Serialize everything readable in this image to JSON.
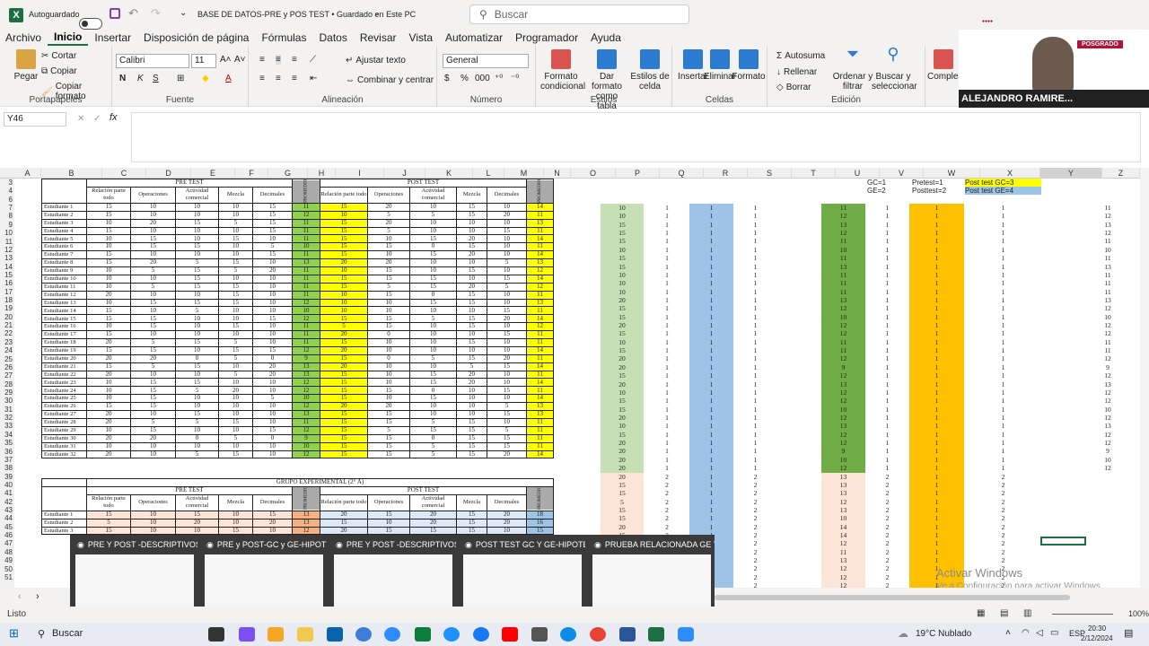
{
  "titlebar": {
    "autosave": "Autoguardado",
    "doc_title": "BASE DE DATOS-PRE y POS TEST • Guardado en Este PC"
  },
  "search": {
    "placeholder": "Buscar"
  },
  "menu": [
    "Archivo",
    "Inicio",
    "Insertar",
    "Disposición de página",
    "Fórmulas",
    "Datos",
    "Revisar",
    "Vista",
    "Automatizar",
    "Programador",
    "Ayuda"
  ],
  "ribbon": {
    "paste": "Pegar",
    "cut": "Cortar",
    "copy": "Copiar",
    "copy_format": "Copiar formato",
    "clipboard": "Portapapeles",
    "font_name": "Calibri",
    "font_size": "11",
    "font": "Fuente",
    "wrap": "Ajustar texto",
    "merge": "Combinar y centrar",
    "alignment": "Alineación",
    "number_format": "General",
    "number": "Número",
    "cond_format": "Formato condicional",
    "table_format": "Dar formato como tabla",
    "cell_styles": "Estilos de celda",
    "styles": "Estilos",
    "insert": "Insertar",
    "delete": "Eliminar",
    "format": "Formato",
    "cells": "Celdas",
    "autosum": "Autosuma",
    "fill": "Rellenar",
    "clear": "Borrar",
    "sort_filter": "Ordenar y filtrar",
    "find_select": "Buscar y seleccionar",
    "editing": "Edición",
    "complements": "Complem"
  },
  "video": {
    "name": "ALEJANDRO RAMIRE...",
    "badge": "POSGRADO"
  },
  "formula": {
    "namebox": "Y46",
    "fx": "fx"
  },
  "columns": [
    "A",
    "B",
    "C",
    "D",
    "E",
    "F",
    "G",
    "H",
    "I",
    "J",
    "K",
    "L",
    "M",
    "N",
    "O",
    "P",
    "Q",
    "R",
    "S",
    "T",
    "U",
    "V",
    "W",
    "X",
    "Y",
    "Z"
  ],
  "rows": [
    "3",
    "4",
    "6",
    "7",
    "8",
    "9",
    "10",
    "11",
    "12",
    "13",
    "14",
    "15",
    "16",
    "17",
    "18",
    "19",
    "20",
    "21",
    "22",
    "23",
    "24",
    "25",
    "26",
    "27",
    "28",
    "29",
    "30",
    "31",
    "32",
    "33",
    "34",
    "35",
    "36",
    "37",
    "38",
    "39",
    "40",
    "41",
    "42",
    "43",
    "44",
    "45",
    "46",
    "47",
    "48",
    "49",
    "50",
    "51"
  ],
  "table1": {
    "pre_title": "PRE TEST",
    "post_title": "POST TEST",
    "promedio": "PROMEDIO",
    "headers": [
      "Relación parte todo",
      "Operaciones",
      "Actividad comercial",
      "Mezcla",
      "Decimales"
    ],
    "students": [
      "Estudiante 1",
      "Estudiante 2",
      "Estudiante 3",
      "Estudiante 4",
      "Estudiante 5",
      "Estudiante 6",
      "Estudiante 7",
      "Estudiante 8",
      "Estudiante 9",
      "Estudiante 10",
      "Estudiante 11",
      "Estudiante 12",
      "Estudiante 13",
      "Estudiante 14",
      "Estudiante 15",
      "Estudiante 16",
      "Estudiante 17",
      "Estudiante 18",
      "Estudiante 19",
      "Estudiante 20",
      "Estudiante 21",
      "Estudiante 22",
      "Estudiante 23",
      "Estudiante 24",
      "Estudiante 25",
      "Estudiante 26",
      "Estudiante 27",
      "Estudiante 28",
      "Estudiante 29",
      "Estudiante 30",
      "Estudiante 31",
      "Estudiante 32"
    ],
    "pre": [
      [
        15,
        10,
        10,
        10,
        15
      ],
      [
        15,
        10,
        10,
        10,
        15
      ],
      [
        10,
        20,
        15,
        5,
        15
      ],
      [
        15,
        10,
        10,
        10,
        15
      ],
      [
        10,
        15,
        10,
        15,
        10
      ],
      [
        10,
        15,
        15,
        10,
        5
      ],
      [
        15,
        10,
        10,
        10,
        15
      ],
      [
        15,
        20,
        5,
        15,
        10
      ],
      [
        10,
        5,
        15,
        5,
        20
      ],
      [
        10,
        10,
        15,
        10,
        10
      ],
      [
        10,
        5,
        15,
        15,
        10
      ],
      [
        20,
        10,
        10,
        15,
        10
      ],
      [
        10,
        15,
        15,
        15,
        10
      ],
      [
        15,
        10,
        5,
        10,
        10
      ],
      [
        15,
        15,
        10,
        10,
        15
      ],
      [
        10,
        15,
        10,
        15,
        10
      ],
      [
        15,
        10,
        10,
        10,
        10
      ],
      [
        20,
        5,
        15,
        5,
        10
      ],
      [
        15,
        15,
        10,
        15,
        15
      ],
      [
        20,
        20,
        0,
        5,
        0
      ],
      [
        15,
        5,
        15,
        10,
        20
      ],
      [
        20,
        10,
        10,
        5,
        20
      ],
      [
        10,
        15,
        15,
        10,
        10
      ],
      [
        10,
        15,
        5,
        20,
        10
      ],
      [
        10,
        15,
        10,
        10,
        5
      ],
      [
        15,
        15,
        10,
        10,
        10
      ],
      [
        20,
        10,
        15,
        10,
        10
      ],
      [
        20,
        5,
        5,
        15,
        10
      ],
      [
        10,
        15,
        10,
        10,
        15
      ],
      [
        20,
        20,
        0,
        5,
        0
      ],
      [
        10,
        10,
        10,
        10,
        10
      ],
      [
        20,
        10,
        5,
        15,
        10
      ]
    ],
    "pre_avg": [
      11,
      12,
      11,
      11,
      11,
      10,
      11,
      13,
      11,
      11,
      11,
      11,
      12,
      10,
      12,
      11,
      11,
      11,
      12,
      9,
      13,
      13,
      12,
      12,
      10,
      12,
      13,
      11,
      12,
      9,
      10,
      12
    ],
    "post": [
      [
        15,
        20,
        10,
        15,
        10
      ],
      [
        10,
        5,
        5,
        15,
        20
      ],
      [
        15,
        20,
        10,
        10,
        10
      ],
      [
        15,
        5,
        10,
        10,
        15
      ],
      [
        15,
        10,
        15,
        20,
        10
      ],
      [
        15,
        15,
        0,
        15,
        10
      ],
      [
        15,
        10,
        15,
        20,
        10
      ],
      [
        20,
        20,
        10,
        10,
        5
      ],
      [
        10,
        15,
        10,
        15,
        10
      ],
      [
        15,
        15,
        15,
        10,
        15
      ],
      [
        15,
        5,
        15,
        20,
        5
      ],
      [
        10,
        15,
        0,
        15,
        10
      ],
      [
        10,
        10,
        15,
        15,
        10
      ],
      [
        10,
        10,
        10,
        10,
        15
      ],
      [
        15,
        15,
        5,
        15,
        20
      ],
      [
        5,
        15,
        10,
        15,
        10
      ],
      [
        20,
        0,
        10,
        10,
        15
      ],
      [
        15,
        10,
        10,
        15,
        10
      ],
      [
        20,
        10,
        10,
        10,
        10
      ],
      [
        15,
        0,
        5,
        15,
        20
      ],
      [
        20,
        10,
        10,
        5,
        15
      ],
      [
        15,
        10,
        15,
        20,
        10
      ],
      [
        15,
        10,
        15,
        20,
        10
      ],
      [
        15,
        15,
        0,
        10,
        15
      ],
      [
        15,
        10,
        15,
        10,
        10
      ],
      [
        20,
        20,
        10,
        10,
        5
      ],
      [
        15,
        15,
        10,
        10,
        15
      ],
      [
        15,
        15,
        5,
        15,
        10
      ],
      [
        15,
        5,
        15,
        15,
        5
      ],
      [
        15,
        15,
        0,
        15,
        15
      ],
      [
        15,
        15,
        5,
        15,
        15
      ],
      [
        15,
        15,
        5,
        15,
        20
      ]
    ],
    "post_avg": [
      14,
      11,
      13,
      11,
      14,
      11,
      14,
      13,
      12,
      14,
      12,
      11,
      13,
      11,
      14,
      12,
      11,
      11,
      14,
      11,
      14,
      11,
      14,
      11,
      14,
      13,
      13,
      11,
      11,
      11,
      11,
      14
    ]
  },
  "table2": {
    "title": "GRUPO EXPERIMENTAL (2° A)",
    "pre_title": "PRE TEST",
    "post_title": "POST TEST",
    "promedio": "PROMEDIO",
    "headers": [
      "Relación parte todo",
      "Operaciones",
      "Actividad comercial",
      "Mezcla",
      "Decimales"
    ],
    "students": [
      "Estudiante 1",
      "Estudiante 2",
      "Estudiante 3"
    ],
    "pre": [
      [
        15,
        10,
        15,
        10,
        15
      ],
      [
        5,
        10,
        20,
        10,
        20
      ],
      [
        15,
        10,
        10,
        15,
        10
      ]
    ],
    "pre_avg": [
      13,
      13,
      12
    ],
    "post": [
      [
        20,
        15,
        20,
        15,
        20
      ],
      [
        15,
        10,
        20,
        15,
        20
      ],
      [
        20,
        15,
        15,
        15,
        10
      ]
    ],
    "post_avg": [
      18,
      16,
      15
    ]
  },
  "col_p": [
    10,
    10,
    15,
    15,
    15,
    10,
    15,
    15,
    10,
    10,
    10,
    20,
    15,
    15,
    20,
    15,
    10,
    15,
    20,
    20,
    15,
    20,
    10,
    15,
    15,
    20,
    10,
    15,
    20,
    20,
    20,
    20,
    20,
    15,
    15,
    5,
    15,
    15,
    20,
    15,
    15,
    10,
    20,
    15,
    20,
    10,
    20,
    15,
    15
  ],
  "col_q": [
    1,
    1,
    1,
    1,
    1,
    1,
    1,
    1,
    1,
    1,
    1,
    1,
    1,
    1,
    1,
    1,
    1,
    1,
    1,
    1,
    1,
    1,
    1,
    1,
    1,
    1,
    1,
    1,
    1,
    1,
    1,
    1,
    2,
    2,
    2,
    2,
    2,
    2,
    2,
    2,
    2,
    2,
    2,
    2,
    2,
    2,
    2
  ],
  "col_r": [
    1,
    1,
    1,
    1,
    1,
    1,
    1,
    1,
    1,
    1,
    1,
    1,
    1,
    1,
    1,
    1,
    1,
    1,
    1,
    1,
    1,
    1,
    1,
    1,
    1,
    1,
    1,
    1,
    1,
    1,
    1,
    1,
    1,
    1,
    1,
    1,
    1,
    1,
    1,
    1,
    1,
    1,
    1,
    1,
    1,
    1,
    1
  ],
  "col_s": [
    1,
    1,
    1,
    1,
    1,
    1,
    1,
    1,
    1,
    1,
    1,
    1,
    1,
    1,
    1,
    1,
    1,
    1,
    1,
    1,
    1,
    1,
    1,
    1,
    1,
    1,
    1,
    1,
    1,
    1,
    1,
    1,
    2,
    2,
    2,
    2,
    2,
    2,
    2,
    2,
    2,
    2,
    2,
    2,
    2,
    2,
    2
  ],
  "col_u": [
    11,
    12,
    13,
    12,
    11,
    10,
    11,
    13,
    11,
    11,
    11,
    13,
    12,
    10,
    12,
    12,
    11,
    11,
    12,
    9,
    12,
    13,
    12,
    12,
    10,
    12,
    13,
    12,
    12,
    9,
    10,
    12,
    13,
    13,
    13,
    12,
    13,
    10,
    14,
    14,
    12,
    11,
    13,
    12,
    12,
    12,
    10
  ],
  "col_v": [
    1,
    1,
    1,
    1,
    1,
    1,
    1,
    1,
    1,
    1,
    1,
    1,
    1,
    1,
    1,
    1,
    1,
    1,
    1,
    1,
    1,
    1,
    1,
    1,
    1,
    1,
    1,
    1,
    1,
    1,
    1,
    1,
    2,
    2,
    2,
    2,
    2,
    2,
    2,
    2,
    2,
    2,
    2,
    2,
    2,
    2,
    2
  ],
  "col_w": [
    1,
    1,
    1,
    1,
    1,
    1,
    1,
    1,
    1,
    1,
    1,
    1,
    1,
    1,
    1,
    1,
    1,
    1,
    1,
    1,
    1,
    1,
    1,
    1,
    1,
    1,
    1,
    1,
    1,
    1,
    1,
    1,
    1,
    1,
    1,
    1,
    1,
    1,
    1,
    1,
    1,
    1,
    1,
    1,
    1,
    1,
    1
  ],
  "col_x": [
    1,
    1,
    1,
    1,
    1,
    1,
    1,
    1,
    1,
    1,
    1,
    1,
    1,
    1,
    1,
    1,
    1,
    1,
    1,
    1,
    1,
    1,
    1,
    1,
    1,
    1,
    1,
    1,
    1,
    1,
    1,
    1,
    2,
    2,
    2,
    2,
    2,
    2,
    2,
    2,
    2,
    2,
    2,
    2,
    2,
    2,
    2
  ],
  "col_z": [
    11,
    12,
    13,
    12,
    11,
    10,
    11,
    13,
    11,
    11,
    11,
    13,
    12,
    10,
    12,
    12,
    11,
    11,
    12,
    9,
    12,
    13,
    12,
    12,
    10,
    12,
    13,
    12,
    12,
    9,
    10,
    12
  ],
  "legend": {
    "gc": "GC=1",
    "ge": "GE=2",
    "pretest": "Pretest=1",
    "posttest": "Posttest=2",
    "post_gc": "Post test GC=3",
    "post_ge": "Post test GE=4"
  },
  "previews": [
    "PRE Y POST -DESCRIPTIVOS-PR...",
    "PRE y POST-GC y GE-HIPOTESIS ...",
    "PRE Y POST -DESCRIPTIVOS-IN...",
    "POST TEST GC Y GE-HIPOTESIS ...",
    "PRUEBA RELACIONADA GE Y G..."
  ],
  "watermark": {
    "line1": "Activar Windows",
    "line2": "Ve a Configuración para activar Windows"
  },
  "status": {
    "ready": "Listo",
    "zoom": "100%"
  },
  "taskbar": {
    "search": "Buscar",
    "weather": "19°C Nublado",
    "lang": "ESP",
    "time": "20:30",
    "date": "2/12/2024"
  },
  "colors": {
    "excel_green": "#1d6f42",
    "pre_avg": "#92d050",
    "post_avg": "#ffff00",
    "band_green": "#c6e0b4",
    "band_blue": "#9dc3e6",
    "band_peach": "#fce4d6",
    "band_green2": "#70ad47",
    "band_orange": "#ffc000"
  }
}
